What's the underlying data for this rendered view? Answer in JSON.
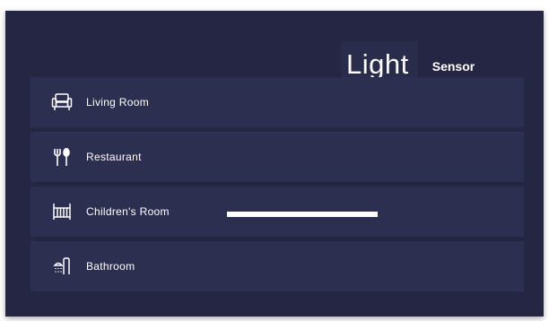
{
  "tabs": {
    "light_label": "Light",
    "sensor_label": "Sensor"
  },
  "rooms": [
    {
      "label": "Living Room",
      "icon": "sofa-icon"
    },
    {
      "label": "Restaurant",
      "icon": "fork-spoon-icon"
    },
    {
      "label": "Children's Room",
      "icon": "crib-icon"
    },
    {
      "label": "Bathroom",
      "icon": "shower-icon"
    }
  ],
  "colors": {
    "panel_background": "#252643",
    "row_background": "#2d2f50",
    "active_tab_background": "#2a2c4c",
    "text": "#ffffff"
  }
}
